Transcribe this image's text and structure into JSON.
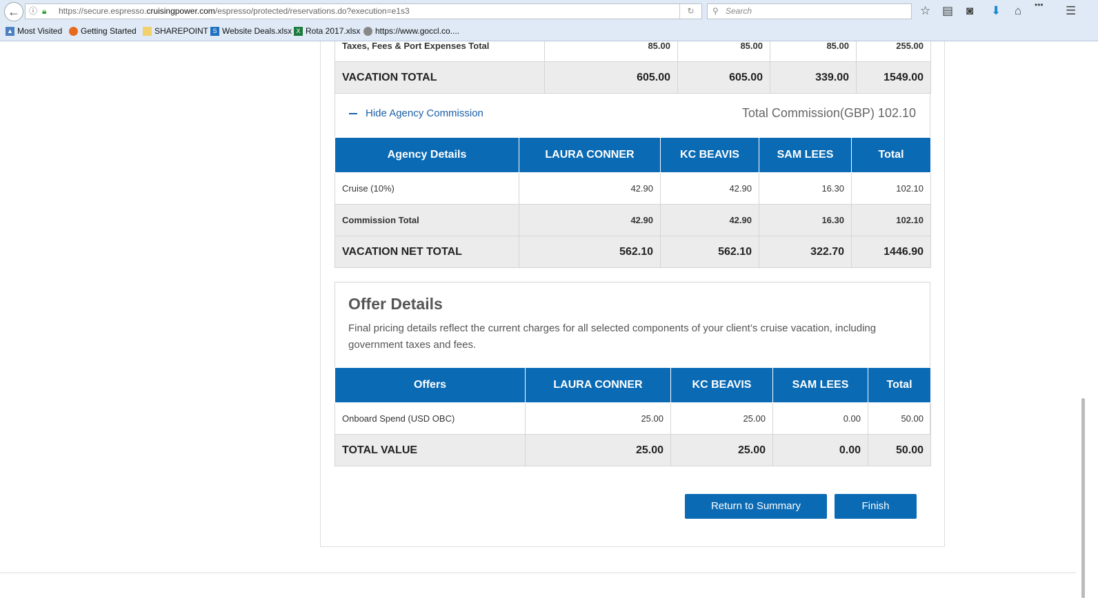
{
  "browser": {
    "url_prefix": "https://secure.espresso.",
    "url_domain": "cruisingpower.com",
    "url_path": "/espresso/protected/reservations.do?execution=e1s3",
    "search_placeholder": "Search",
    "bookmarks": [
      "Most Visited",
      "Getting Started",
      "SHAREPOINT",
      "Website Deals.xlsx",
      "Rota 2017.xlsx",
      "https://www.goccl.co...."
    ]
  },
  "pricing": {
    "rows": [
      {
        "label": "Taxes, Fees & Port Expenses Total",
        "values": [
          "85.00",
          "85.00",
          "85.00",
          "255.00"
        ]
      },
      {
        "label": "VACATION TOTAL",
        "values": [
          "605.00",
          "605.00",
          "339.00",
          "1549.00"
        ]
      }
    ]
  },
  "commission": {
    "hide_label": "Hide Agency Commission",
    "total_label": "Total Commission(GBP) 102.10",
    "headers": [
      "Agency Details",
      "LAURA CONNER",
      "KC BEAVIS",
      "SAM LEES",
      "Total"
    ],
    "rows": [
      {
        "label": "Cruise (10%)",
        "values": [
          "42.90",
          "42.90",
          "16.30",
          "102.10"
        ]
      },
      {
        "label": "Commission Total",
        "values": [
          "42.90",
          "42.90",
          "16.30",
          "102.10"
        ]
      },
      {
        "label": "VACATION NET TOTAL",
        "values": [
          "562.10",
          "562.10",
          "322.70",
          "1446.90"
        ]
      }
    ]
  },
  "offers": {
    "title": "Offer Details",
    "description": "Final pricing details reflect the current charges for all selected components of your client’s cruise vacation, including government taxes and fees.",
    "headers": [
      "Offers",
      "LAURA CONNER",
      "KC BEAVIS",
      "SAM LEES",
      "Total"
    ],
    "rows": [
      {
        "label": "Onboard Spend (USD OBC)",
        "values": [
          "25.00",
          "25.00",
          "0.00",
          "50.00"
        ]
      },
      {
        "label": "TOTAL VALUE",
        "values": [
          "25.00",
          "25.00",
          "0.00",
          "50.00"
        ]
      }
    ]
  },
  "buttons": {
    "return": "Return to Summary",
    "finish": "Finish"
  }
}
